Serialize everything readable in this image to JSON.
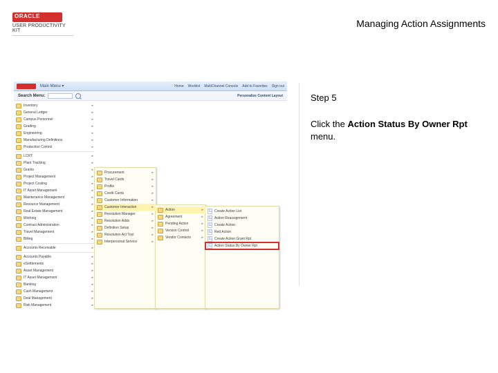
{
  "doc": {
    "brand_sub": "USER PRODUCTIVITY KIT",
    "title": "Managing Action Assignments"
  },
  "instruction": {
    "step_label": "Step 5",
    "line1": "Click the ",
    "bold": "Action Status By Owner Rpt",
    "line2": " menu."
  },
  "shot": {
    "main_menu_label": "Main Menu",
    "search_label": "Search Menu:",
    "personalize": "Personalize Content  Layout",
    "toplinks": [
      "Home",
      "Worklist",
      "MultiChannel Console",
      "Add to Favorites",
      "Sign out"
    ],
    "col1": [
      "Inventory",
      "General Ledger",
      "Campus Personnel",
      "Grading",
      "Engineering",
      "Manufacturing Definitions",
      "Production Control",
      "",
      "LCRT",
      "Plant Tracking",
      "Grants",
      "Project Management",
      "Project Costing",
      "IT Asset Management",
      "Maintenance Management",
      "Resource Management",
      "Real Estate Management",
      "Working",
      "Contract Administration",
      "Travel Management",
      "Billing",
      "",
      "Accounts Receivable",
      "",
      "Accounts Payable",
      "eSettlements",
      "Asset Management",
      "IT Asset Management",
      "Banking",
      "Cash Management",
      "Deal Management",
      "Risk Management"
    ],
    "col2": [
      "Procurement",
      "Travel Cards",
      "Profile",
      "Credit Cards",
      "Customer Information",
      "Customer Interaction",
      "Resolution Manager",
      "Resolution Adds",
      "Definition Setup",
      "Resolution Act Tool",
      "Interpersonal Service"
    ],
    "col3": [
      "Action",
      "Agreement",
      "Pending Action",
      "Version Control",
      "Vendor Contacts"
    ],
    "col4": [
      "Create Action List",
      "Action Reassignment",
      "Create Action",
      "Red Action",
      "Create Action Grant Rpt",
      "Action Status By Owner Rpt"
    ]
  }
}
